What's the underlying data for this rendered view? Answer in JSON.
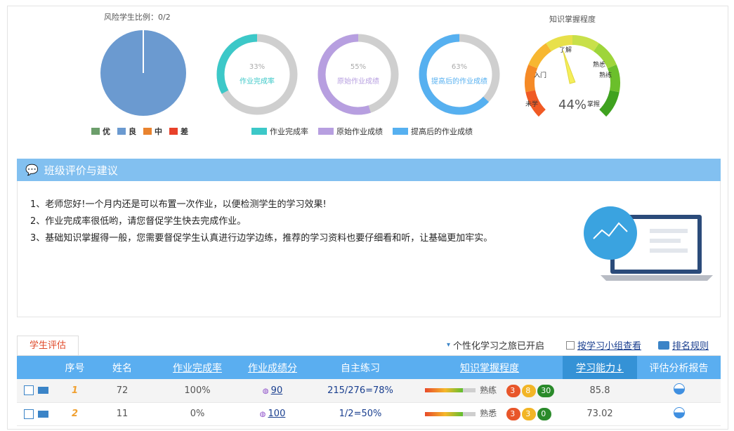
{
  "risk": {
    "title": "风险学生比例：0/2",
    "legend": [
      {
        "label": "优",
        "color": "#6c9e6b"
      },
      {
        "label": "良",
        "color": "#6b9ad0"
      },
      {
        "label": "中",
        "color": "#e9832e"
      },
      {
        "label": "差",
        "color": "#e8412a"
      }
    ]
  },
  "donuts": [
    {
      "pct": "33%",
      "label": "作业完成率",
      "value": 0.33,
      "color": "#3cc8c8",
      "text_color": "#3cc8c8"
    },
    {
      "pct": "55%",
      "label": "原始作业成绩",
      "value": 0.55,
      "color": "#b79fe0",
      "text_color": "#b79fe0"
    },
    {
      "pct": "63%",
      "label": "提高后的作业成绩",
      "value": 0.63,
      "color": "#56b0f0",
      "text_color": "#56b0f0"
    }
  ],
  "donut_legend": [
    {
      "label": "作业完成率",
      "color": "#3cc8c8"
    },
    {
      "label": "原始作业成绩",
      "color": "#b79fe0"
    },
    {
      "label": "提高后的作业成绩",
      "color": "#56b0f0"
    }
  ],
  "gauge": {
    "title": "知识掌握程度",
    "value": "44%",
    "level": 0.44,
    "labels": {
      "l1": "未学",
      "l2": "入门",
      "l3": "了解",
      "l4": "熟悉",
      "l5": "熟练",
      "l6": "掌握"
    }
  },
  "section": {
    "title": "班级评价与建议",
    "lines": [
      "1、老师您好!一个月内还是可以布置一次作业，以便检测学生的学习效果!",
      "2、作业完成率很低哟，请您督促学生快去完成作业。",
      "3、基础知识掌握得一般，您需要督促学生认真进行边学边练，推荐的学习资料也要仔细看和听，让基础更加牢实。"
    ]
  },
  "tab": "学生评估",
  "tools": {
    "journey": "个性化学习之旅已开启",
    "group": "按学习小组查看",
    "rank": "排名规则"
  },
  "columns": [
    "序号",
    "姓名",
    "作业完成率",
    "作业成绩分",
    "自主练习",
    "知识掌握程度",
    "学习能力↓",
    "评估分析报告"
  ],
  "rows": [
    {
      "idx": "1",
      "name": "72",
      "completion": "100%",
      "score": "90",
      "practice": "215/276=78%",
      "mastery": "熟练",
      "badges": [
        "3",
        "8",
        "30"
      ],
      "ability": "85.8"
    },
    {
      "idx": "2",
      "name": "11",
      "completion": "0%",
      "score": "100",
      "practice": "1/2=50%",
      "mastery": "熟悉",
      "badges": [
        "3",
        "3",
        "0"
      ],
      "ability": "73.02"
    }
  ]
}
